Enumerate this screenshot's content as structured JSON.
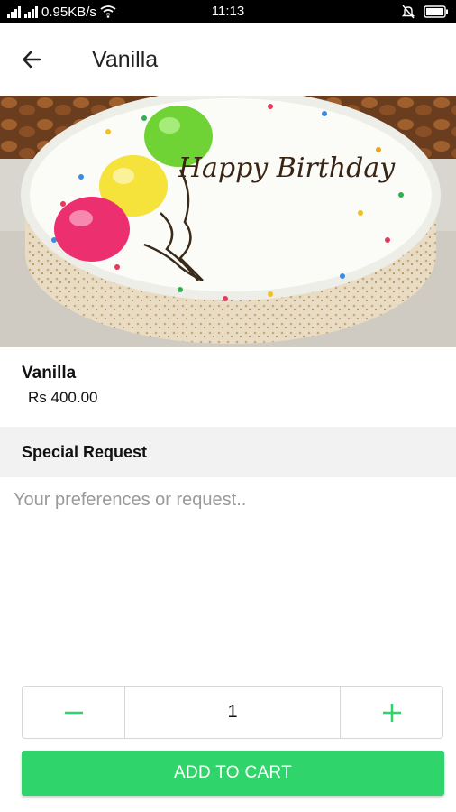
{
  "status_bar": {
    "network_speed": "0.95KB/s",
    "time": "11:13"
  },
  "app_bar": {
    "title": "Vanilla",
    "back_icon": "arrow-left-icon"
  },
  "hero": {
    "text": "Happy Birthday"
  },
  "product": {
    "name": "Vanilla",
    "price": "Rs 400.00"
  },
  "special_request": {
    "header": "Special Request",
    "placeholder": "Your preferences or request..",
    "value": ""
  },
  "quantity": {
    "value": "1",
    "decrement_icon": "minus-icon",
    "increment_icon": "plus-icon"
  },
  "actions": {
    "add_to_cart_label": "ADD TO CART"
  },
  "colors": {
    "accent": "#2fd46a",
    "section_bg": "#f2f2f2"
  }
}
